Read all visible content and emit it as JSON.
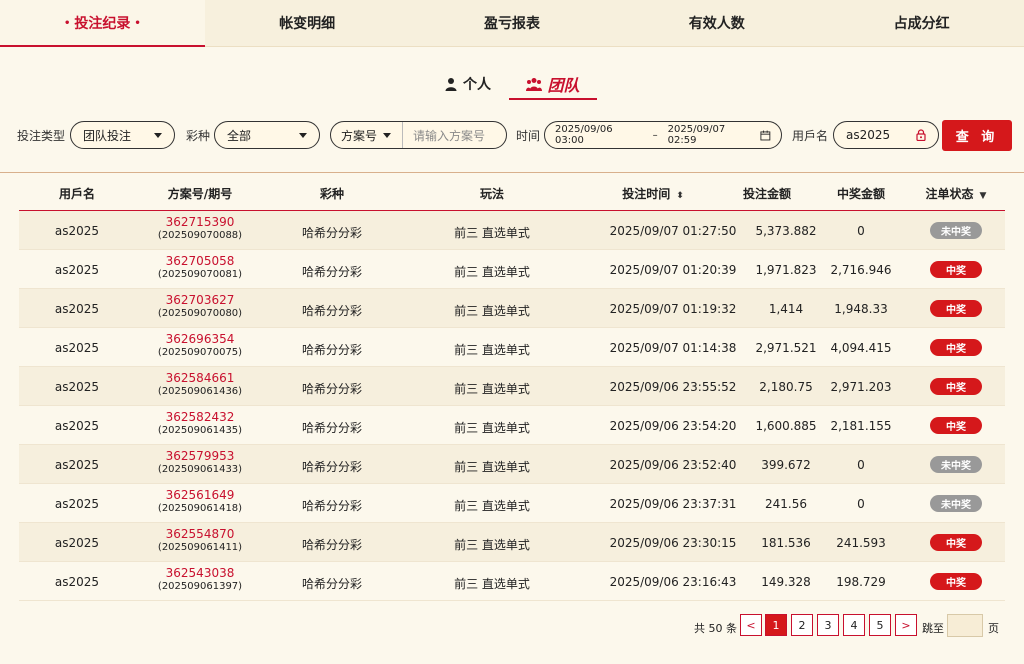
{
  "top_tabs": [
    "投注纪录",
    "帐变明细",
    "盈亏报表",
    "有效人数",
    "占成分红"
  ],
  "switch": {
    "person": "个人",
    "team": "团队"
  },
  "filters": {
    "bet_type_label": "投注类型",
    "bet_type_value": "团队投注",
    "lottery_label": "彩种",
    "lottery_value": "全部",
    "plan_select": "方案号",
    "plan_placeholder": "请输入方案号",
    "time_label": "时间",
    "date_from": "2025/09/06 03:00",
    "date_sep": "–",
    "date_to": "2025/09/07 02:59",
    "username_label": "用戶名",
    "username_value": "as2025",
    "search_button": "查 询"
  },
  "table": {
    "headers": [
      "用戶名",
      "方案号/期号",
      "彩种",
      "玩法",
      "投注时间",
      "投注金额",
      "中奖金额",
      "注单状态"
    ],
    "rows": [
      {
        "user": "as2025",
        "plan": "362715390",
        "issue": "(202509070088)",
        "lottery": "哈希分分彩",
        "play": "前三 直选单式",
        "time": "2025/09/07 01:27:50",
        "amount": "5,373.882",
        "win": "0",
        "status": "未中奖"
      },
      {
        "user": "as2025",
        "plan": "362705058",
        "issue": "(202509070081)",
        "lottery": "哈希分分彩",
        "play": "前三 直选单式",
        "time": "2025/09/07 01:20:39",
        "amount": "1,971.823",
        "win": "2,716.946",
        "status": "中奖"
      },
      {
        "user": "as2025",
        "plan": "362703627",
        "issue": "(202509070080)",
        "lottery": "哈希分分彩",
        "play": "前三 直选单式",
        "time": "2025/09/07 01:19:32",
        "amount": "1,414",
        "win": "1,948.33",
        "status": "中奖"
      },
      {
        "user": "as2025",
        "plan": "362696354",
        "issue": "(202509070075)",
        "lottery": "哈希分分彩",
        "play": "前三 直选单式",
        "time": "2025/09/07 01:14:38",
        "amount": "2,971.521",
        "win": "4,094.415",
        "status": "中奖"
      },
      {
        "user": "as2025",
        "plan": "362584661",
        "issue": "(202509061436)",
        "lottery": "哈希分分彩",
        "play": "前三 直选单式",
        "time": "2025/09/06 23:55:52",
        "amount": "2,180.75",
        "win": "2,971.203",
        "status": "中奖"
      },
      {
        "user": "as2025",
        "plan": "362582432",
        "issue": "(202509061435)",
        "lottery": "哈希分分彩",
        "play": "前三 直选单式",
        "time": "2025/09/06 23:54:20",
        "amount": "1,600.885",
        "win": "2,181.155",
        "status": "中奖"
      },
      {
        "user": "as2025",
        "plan": "362579953",
        "issue": "(202509061433)",
        "lottery": "哈希分分彩",
        "play": "前三 直选单式",
        "time": "2025/09/06 23:52:40",
        "amount": "399.672",
        "win": "0",
        "status": "未中奖"
      },
      {
        "user": "as2025",
        "plan": "362561649",
        "issue": "(202509061418)",
        "lottery": "哈希分分彩",
        "play": "前三 直选单式",
        "time": "2025/09/06 23:37:31",
        "amount": "241.56",
        "win": "0",
        "status": "未中奖"
      },
      {
        "user": "as2025",
        "plan": "362554870",
        "issue": "(202509061411)",
        "lottery": "哈希分分彩",
        "play": "前三 直选单式",
        "time": "2025/09/06 23:30:15",
        "amount": "181.536",
        "win": "241.593",
        "status": "中奖"
      },
      {
        "user": "as2025",
        "plan": "362543038",
        "issue": "(202509061397)",
        "lottery": "哈希分分彩",
        "play": "前三 直选单式",
        "time": "2025/09/06 23:16:43",
        "amount": "149.328",
        "win": "198.729",
        "status": "中奖"
      }
    ]
  },
  "pager": {
    "total": "共 50 条",
    "prev": "<",
    "pages": [
      "1",
      "2",
      "3",
      "4",
      "5"
    ],
    "next": ">",
    "jump_label": "跳至",
    "page_suffix": "页"
  },
  "colors": {
    "accent": "#c8102e",
    "background": "#fcf8ec",
    "win_badge": "#d5181b",
    "lose_badge": "#999999"
  }
}
